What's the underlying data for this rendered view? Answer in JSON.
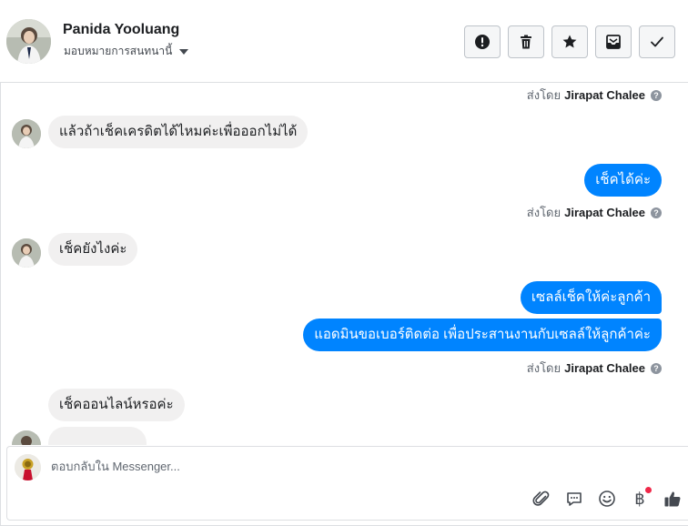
{
  "header": {
    "contact_name": "Panida Yooluang",
    "assign_label": "มอบหมายการสนทนานี้"
  },
  "actions": [
    {
      "name": "mark-spam",
      "icon": "exclamation-circle-icon"
    },
    {
      "name": "delete",
      "icon": "trash-icon"
    },
    {
      "name": "star",
      "icon": "star-icon"
    },
    {
      "name": "move-to-done",
      "icon": "inbox-icon"
    },
    {
      "name": "mark-done",
      "icon": "check-icon"
    }
  ],
  "sent_by_prefix": "ส่งโดย",
  "agent_name": "Jirapat Chalee",
  "help_glyph": "?",
  "messages": {
    "in1": "แล้วถ้าเช็คเครดิตได้ไหมค่ะเพื่อออกไม่ได้",
    "out1": "เช็คได้ค่ะ",
    "in2": "เช็คยังไงค่ะ",
    "out2a": "เซลล์เช็คให้ค่ะลูกค้า",
    "out2b": "แอดมินขอเบอร์ติดต่อ เพื่อประสานงานกับเซลล์ให้ลูกค้าค่ะ",
    "in3": "เช็คออนไลน์หรอค่ะ"
  },
  "composer": {
    "placeholder": "ตอบกลับใน Messenger..."
  },
  "tools": {
    "baht_glyph": "฿"
  },
  "colors": {
    "outgoing_bubble": "#0084ff",
    "incoming_bubble": "#f1f0f0",
    "notification_dot": "#f02849"
  }
}
